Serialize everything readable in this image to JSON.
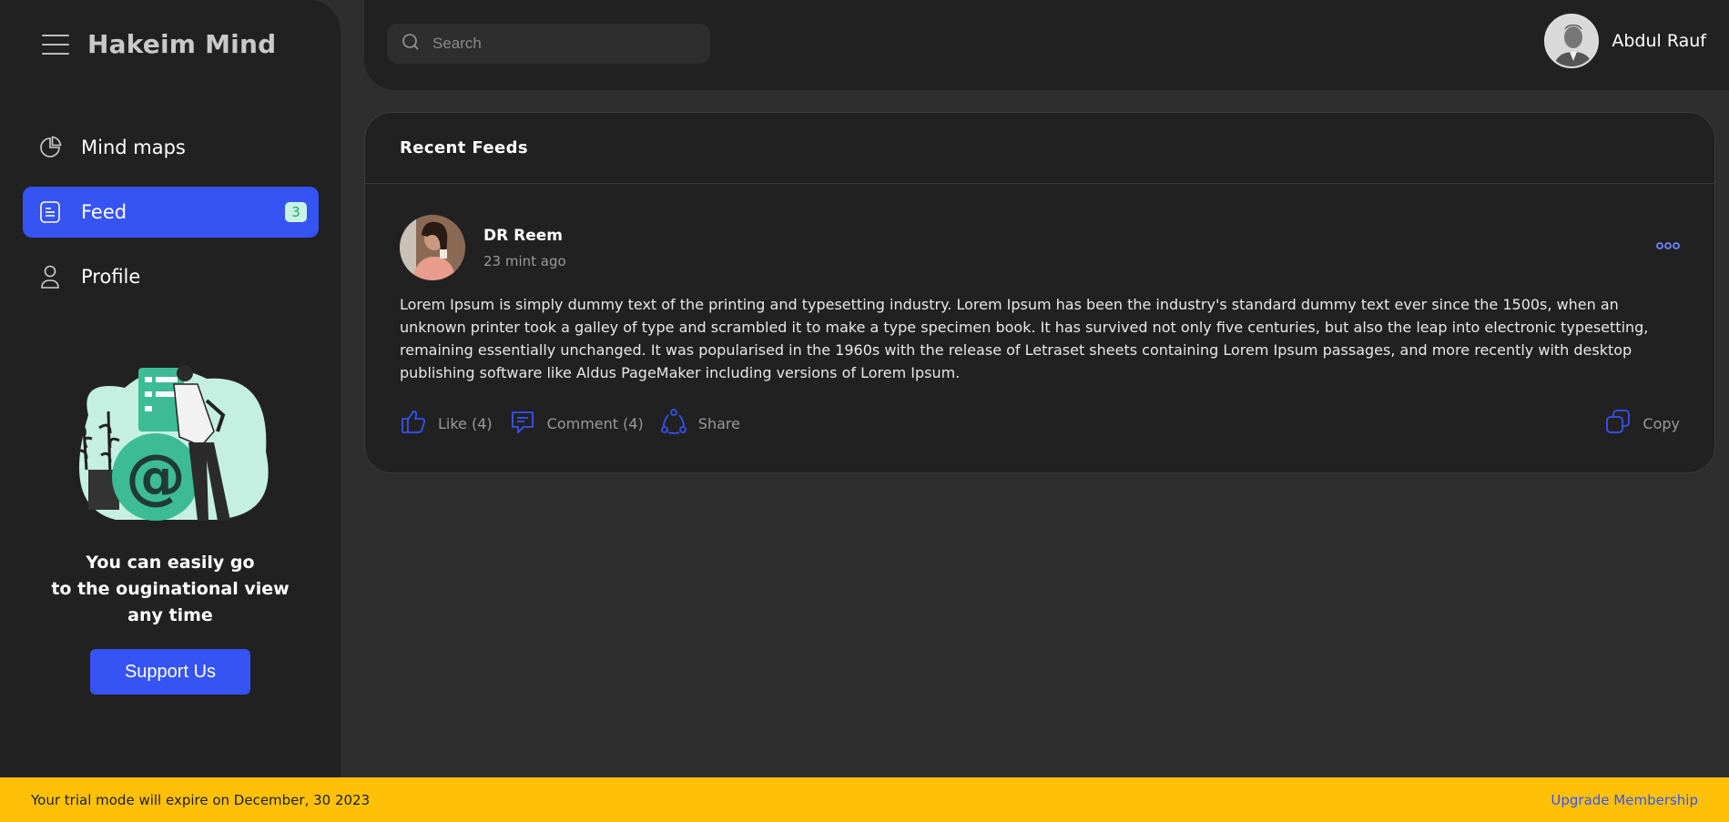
{
  "app": {
    "title": "Hakeim Mind"
  },
  "sidebar": {
    "items": [
      {
        "label": "Mind maps",
        "icon": "pie-chart-icon"
      },
      {
        "label": "Feed",
        "icon": "document-icon",
        "badge": "3",
        "active": true
      },
      {
        "label": "Profile",
        "icon": "user-icon"
      }
    ],
    "promo": {
      "line1": "You can easily go",
      "line2": "to the ouginational view",
      "line3": "any time",
      "button": "Support Us"
    }
  },
  "header": {
    "search_placeholder": "Search",
    "user_name": "Abdul Rauf"
  },
  "feed": {
    "title": "Recent Feeds",
    "posts": [
      {
        "author": "DR Reem",
        "time": "23 mint ago",
        "body": "Lorem Ipsum is simply dummy text of the printing and typesetting industry. Lorem Ipsum has been the industry's standard dummy text ever since the 1500s, when an unknown printer took a galley of type and scrambled it to make a type specimen book. It has survived not only five centuries, but also the leap into electronic typesetting, remaining essentially unchanged. It was popularised in the 1960s with the release of Letraset sheets containing Lorem Ipsum passages, and more recently with desktop publishing software like Aldus PageMaker including versions of Lorem Ipsum.",
        "like_label": "Like (4)",
        "comment_label": "Comment (4)",
        "share_label": "Share",
        "copy_label": "Copy"
      }
    ]
  },
  "footer": {
    "trial_text": "Your trial mode will expire on December, 30 2023",
    "upgrade_label": "Upgrade Membership"
  },
  "colors": {
    "accent": "#3653f4",
    "sidebar_bg": "#212121",
    "page_bg": "#2e2e2e",
    "footer_bg": "#ffc107",
    "badge_bg": "#c6f2e4"
  }
}
